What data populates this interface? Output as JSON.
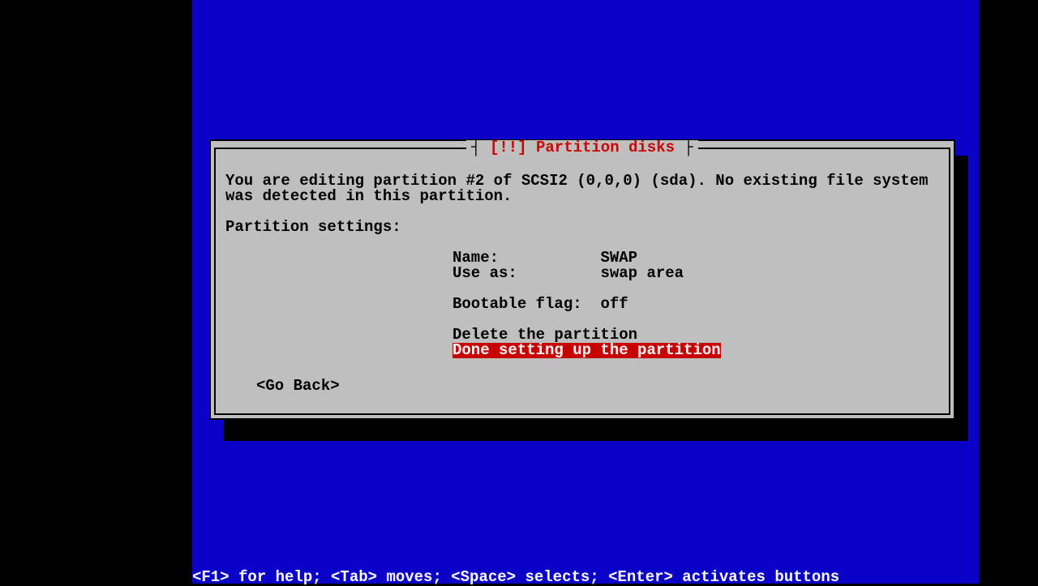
{
  "dialog": {
    "title_prefix": "[!!] ",
    "title_text": "Partition disks",
    "description": "You are editing partition #2 of SCSI2 (0,0,0) (sda). No existing file system was detected in this partition.",
    "subheading": "Partition settings:",
    "settings": [
      {
        "label": "Name:",
        "value": "SWAP"
      },
      {
        "label": "Use as:",
        "value": "swap area"
      },
      {
        "label": "Bootable flag:",
        "value": "off"
      }
    ],
    "actions": [
      "Delete the partition",
      "Done setting up the partition"
    ],
    "selected_action_index": 1,
    "go_back": "<Go Back>"
  },
  "helpbar": "<F1> for help; <Tab> moves; <Space> selects; <Enter> activates buttons"
}
